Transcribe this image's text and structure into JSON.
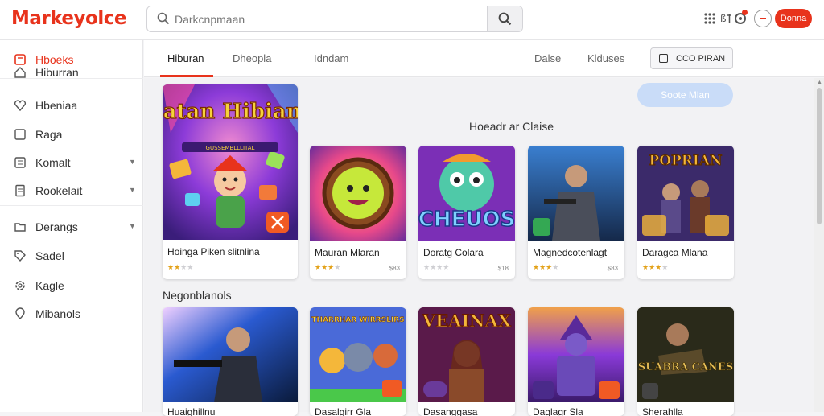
{
  "header": {
    "logo": "Markeyolce",
    "search_value": "Darkcnpmaan",
    "donate_label": "Donna"
  },
  "sidebar": {
    "top_item": "Hboeks",
    "items": [
      {
        "label": "Hiburran",
        "icon": "home-icon",
        "chevron": false
      },
      {
        "label": "Hbeniaa",
        "icon": "heart-icon",
        "chevron": false
      },
      {
        "label": "Raga",
        "icon": "bookmark-icon",
        "chevron": false
      },
      {
        "label": "Komalt",
        "icon": "list-icon",
        "chevron": true
      },
      {
        "label": "Rookelait",
        "icon": "document-icon",
        "chevron": true
      },
      {
        "label": "Derangs",
        "icon": "folder-icon",
        "chevron": true
      },
      {
        "label": "Sadel",
        "icon": "tag-icon",
        "chevron": false
      },
      {
        "label": "Kagle",
        "icon": "gear-icon",
        "chevron": false
      },
      {
        "label": "Mibanols",
        "icon": "pin-icon",
        "chevron": false
      }
    ]
  },
  "tabs": [
    {
      "label": "Hiburan",
      "active": true
    },
    {
      "label": "Dheopla",
      "active": false
    },
    {
      "label": "Idndam",
      "active": false
    },
    {
      "label": "Dalse",
      "active": false
    },
    {
      "label": "Klduses",
      "active": false
    }
  ],
  "tab_button": "CCO PIRAN",
  "primary_button": "Soote Mlan",
  "section1_title": "Hoeadr ar Claise",
  "section2_title": "Negonblanols",
  "featured": {
    "art_title": "Ratan Hibiana",
    "art_subtitle": "GUSSEMBLLLITAL",
    "title": "Hoinga Piken slitnlina",
    "rating": 2
  },
  "row1": [
    {
      "title": "Mauran Mlaran",
      "rating": 3,
      "price": "$83",
      "art": "face"
    },
    {
      "title": "Doratg Colara",
      "rating": 0,
      "price": "$18",
      "art": "chelos",
      "art_text": "CHEUOS"
    },
    {
      "title": "Magnedcotenlagt",
      "rating": 3,
      "price": "$83",
      "art": "soldier"
    },
    {
      "title": "Daragca Mlana",
      "rating": 3,
      "price": "",
      "art": "heroes",
      "art_text": "POPRIAN"
    }
  ],
  "row2": [
    {
      "title": "Huaighillnu",
      "art": "gunner"
    },
    {
      "title": "Dasalgirr Gla",
      "art": "cartoon",
      "art_text": "THARRHAR WIRRSLIRS"
    },
    {
      "title": "Dasanggasa",
      "art": "warrior",
      "art_text": "VEAINAX"
    },
    {
      "title": "Daglagr Sla",
      "art": "knight"
    },
    {
      "title": "Sherahlla",
      "art": "mercs",
      "art_text": "SUABRA CANES"
    }
  ],
  "colors": {
    "accent": "#e8331c",
    "star": "#e3a21a",
    "primary_button": "#c9dcf8"
  }
}
